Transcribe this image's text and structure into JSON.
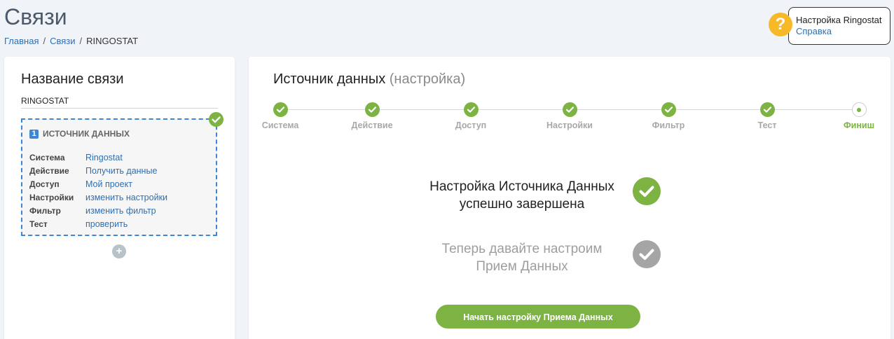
{
  "page": {
    "title": "Связи",
    "breadcrumb": [
      "Главная",
      "Связи",
      "RINGOSTAT"
    ],
    "breadcrumb_sep": "/"
  },
  "help": {
    "icon": "question-icon",
    "glyph": "?",
    "title": "Настройка Ringostat",
    "link": "Справка"
  },
  "left": {
    "title": "Название связи",
    "connection_name": "RINGOSTAT",
    "source": {
      "number": "1",
      "heading": "ИСТОЧНИК ДАННЫХ",
      "rows": [
        {
          "key": "Система",
          "value": "Ringostat"
        },
        {
          "key": "Действие",
          "value": "Получить данные"
        },
        {
          "key": "Доступ",
          "value": "Мой проект"
        },
        {
          "key": "Настройки",
          "value": "изменить настройки"
        },
        {
          "key": "Фильтр",
          "value": "изменить фильтр"
        },
        {
          "key": "Тест",
          "value": "проверить"
        }
      ]
    },
    "add_glyph": "+"
  },
  "right": {
    "title": "Источник данных",
    "title_sub": "(настройка)",
    "steps": [
      {
        "label": "Система",
        "done": true
      },
      {
        "label": "Действие",
        "done": true
      },
      {
        "label": "Доступ",
        "done": true
      },
      {
        "label": "Настройки",
        "done": true
      },
      {
        "label": "Фильтр",
        "done": true
      },
      {
        "label": "Тест",
        "done": true
      },
      {
        "label": "Финиш",
        "done": false,
        "active": true
      }
    ],
    "done_line1": "Настройка Источника Данных",
    "done_line2": "успешно завершена",
    "next_line1": "Теперь давайте настроим",
    "next_line2": "Прием Данных",
    "start_button": "Начать настройку Приема Данных"
  },
  "colors": {
    "accent_green": "#7cb342",
    "link_blue": "#2d6fb3",
    "help_yellow": "#f7b928",
    "dashed_blue": "#3d86d6"
  }
}
